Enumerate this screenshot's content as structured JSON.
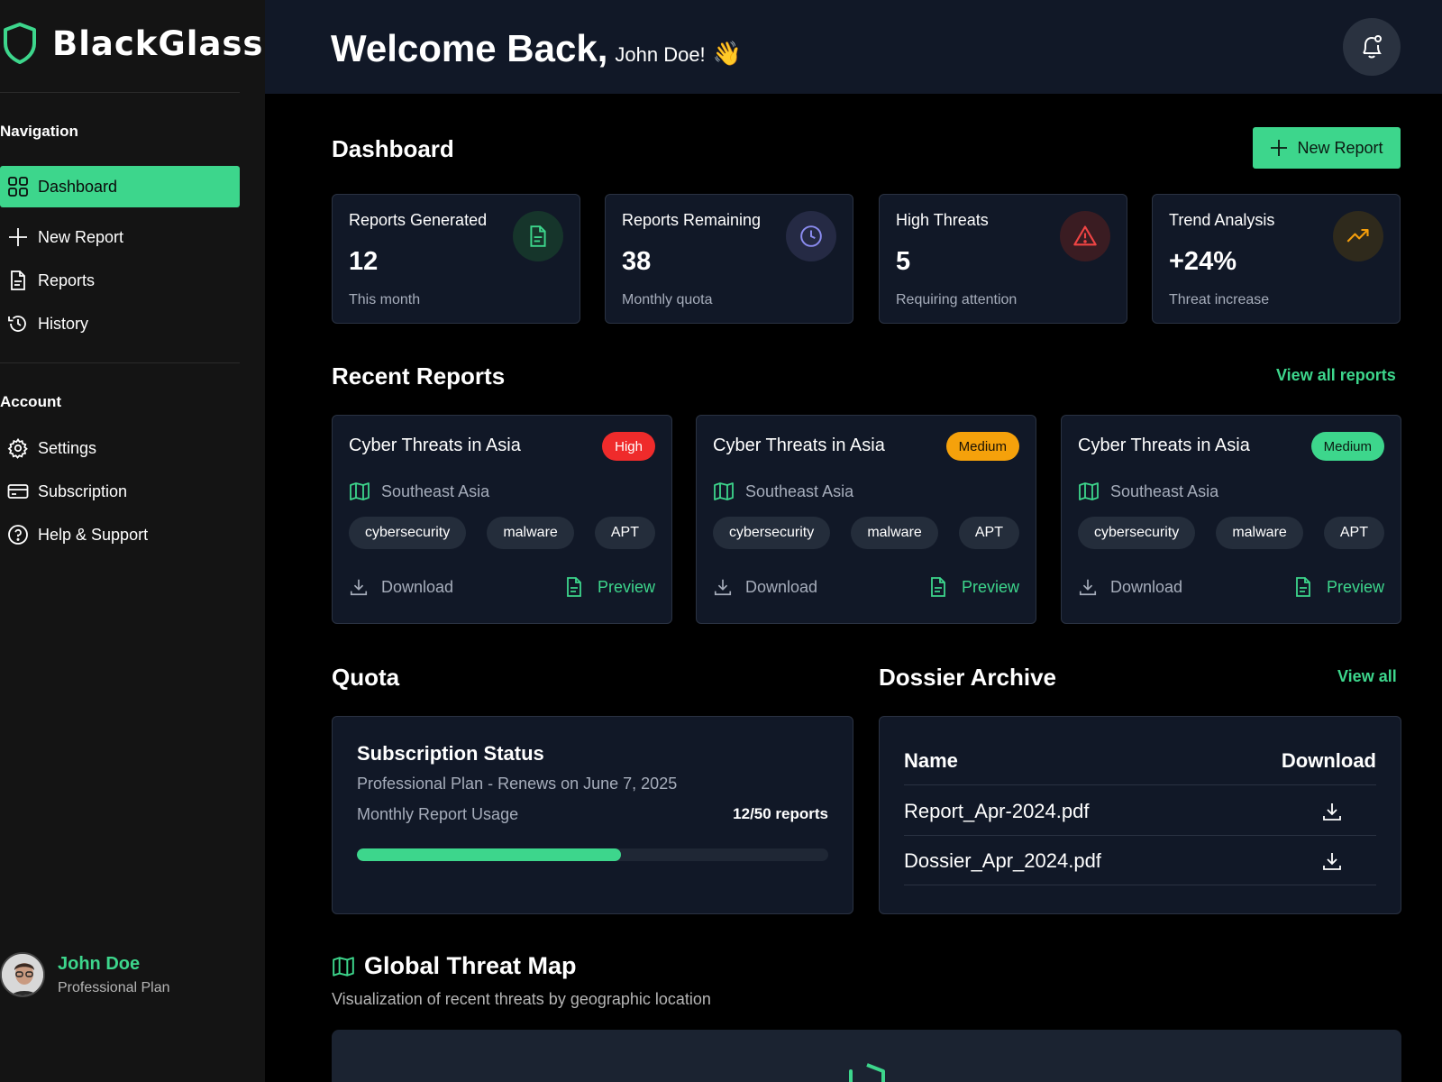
{
  "brand": {
    "name": "BlackGlass"
  },
  "sidebar": {
    "nav_heading": "Navigation",
    "nav_items": [
      {
        "label": "Dashboard",
        "icon": "grid-icon",
        "active": true
      },
      {
        "label": "New Report",
        "icon": "plus-icon"
      },
      {
        "label": "Reports",
        "icon": "document-icon"
      },
      {
        "label": "History",
        "icon": "history-icon"
      }
    ],
    "account_heading": "Account",
    "account_items": [
      {
        "label": "Settings",
        "icon": "gear-icon"
      },
      {
        "label": "Subscription",
        "icon": "credit-card-icon"
      },
      {
        "label": "Help & Support",
        "icon": "help-icon"
      }
    ],
    "user": {
      "name": "John Doe",
      "plan": "Professional Plan"
    }
  },
  "header": {
    "welcome": "Welcome Back,",
    "user_name": "John Doe!",
    "wave_emoji": "👋"
  },
  "dashboard": {
    "title": "Dashboard",
    "new_report_label": "New Report",
    "stats": [
      {
        "label": "Reports Generated",
        "value": "12",
        "sub": "This month",
        "icon": "document-icon",
        "color": "#3dd68c"
      },
      {
        "label": "Reports Remaining",
        "value": "38",
        "sub": "Monthly quota",
        "icon": "clock-icon",
        "color": "#8b8cf0"
      },
      {
        "label": "High Threats",
        "value": "5",
        "sub": "Requiring attention",
        "icon": "alert-icon",
        "color": "#ef4444"
      },
      {
        "label": "Trend Analysis",
        "value": "+24%",
        "sub": "Threat increase",
        "icon": "trending-up-icon",
        "color": "#f59e0b"
      }
    ]
  },
  "recent_reports": {
    "title": "Recent Reports",
    "view_all": "View all reports",
    "items": [
      {
        "title": "Cyber Threats in Asia",
        "severity": "High",
        "severity_color": "#ef2b2b",
        "severity_text_color": "#ffffff",
        "location": "Southeast Asia",
        "tags": [
          "cybersecurity",
          "malware",
          "APT"
        ],
        "download": "Download",
        "preview": "Preview"
      },
      {
        "title": "Cyber Threats in Asia",
        "severity": "Medium",
        "severity_color": "#f5a10b",
        "severity_text_color": "#1a1205",
        "location": "Southeast Asia",
        "tags": [
          "cybersecurity",
          "malware",
          "APT"
        ],
        "download": "Download",
        "preview": "Preview"
      },
      {
        "title": "Cyber Threats in Asia",
        "severity": "Medium",
        "severity_color": "#3dd68c",
        "severity_text_color": "#0b1a12",
        "location": "Southeast Asia",
        "tags": [
          "cybersecurity",
          "malware",
          "APT"
        ],
        "download": "Download",
        "preview": "Preview"
      }
    ]
  },
  "quota": {
    "title": "Quota",
    "card_title": "Subscription Status",
    "plan_line": "Professional Plan - Renews on June 7, 2025",
    "usage_label": "Monthly Report Usage",
    "usage_text": "12/50 reports",
    "usage_fraction": 0.56
  },
  "dossier": {
    "title": "Dossier Archive",
    "view_all": "View all",
    "col_name": "Name",
    "col_download": "Download",
    "files": [
      "Report_Apr-2024.pdf",
      "Dossier_Apr_2024.pdf"
    ]
  },
  "threat_map": {
    "title": "Global Threat Map",
    "subtitle": "Visualization of recent threats by geographic location"
  },
  "colors": {
    "accent": "#3dd68c",
    "panel": "#111827",
    "sidebar": "#141414"
  }
}
